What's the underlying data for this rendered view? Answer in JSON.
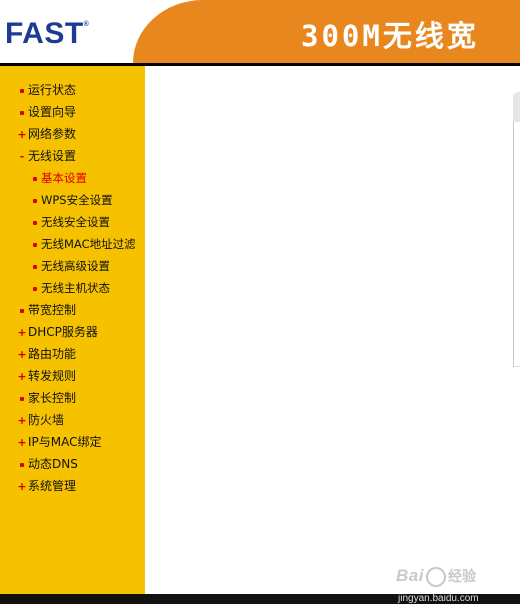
{
  "header": {
    "brand": "FAST",
    "brand_mark": "®",
    "title": "300M无线宽"
  },
  "sidebar": {
    "items": [
      {
        "label": "运行状态",
        "marker": "dot",
        "level": 0
      },
      {
        "label": "设置向导",
        "marker": "dot",
        "level": 0
      },
      {
        "label": "网络参数",
        "marker": "+",
        "level": 0
      },
      {
        "label": "无线设置",
        "marker": "-",
        "level": 0
      },
      {
        "label": "基本设置",
        "marker": "dot",
        "level": 1,
        "active": true
      },
      {
        "label": "WPS安全设置",
        "marker": "dot",
        "level": 1
      },
      {
        "label": "无线安全设置",
        "marker": "dot",
        "level": 1
      },
      {
        "label": "无线MAC地址过滤",
        "marker": "dot",
        "level": 1
      },
      {
        "label": "无线高级设置",
        "marker": "dot",
        "level": 1
      },
      {
        "label": "无线主机状态",
        "marker": "dot",
        "level": 1
      },
      {
        "label": "带宽控制",
        "marker": "dot",
        "level": 0
      },
      {
        "label": "DHCP服务器",
        "marker": "+",
        "level": 0
      },
      {
        "label": "路由功能",
        "marker": "+",
        "level": 0
      },
      {
        "label": "转发规则",
        "marker": "+",
        "level": 0
      },
      {
        "label": "家长控制",
        "marker": "dot",
        "level": 0
      },
      {
        "label": "防火墙",
        "marker": "+",
        "level": 0
      },
      {
        "label": "IP与MAC绑定",
        "marker": "+",
        "level": 0
      },
      {
        "label": "动态DNS",
        "marker": "dot",
        "level": 0
      },
      {
        "label": "系统管理",
        "marker": "+",
        "level": 0
      }
    ]
  },
  "watermark": {
    "logo": "Bai",
    "logo_suffix": "经验",
    "url": "jingyan.baidu.com"
  },
  "colors": {
    "sidebar_bg": "#f6c200",
    "banner_orange": "#e9871f",
    "brand_blue": "#1c3c94",
    "active_red": "#e00000"
  }
}
